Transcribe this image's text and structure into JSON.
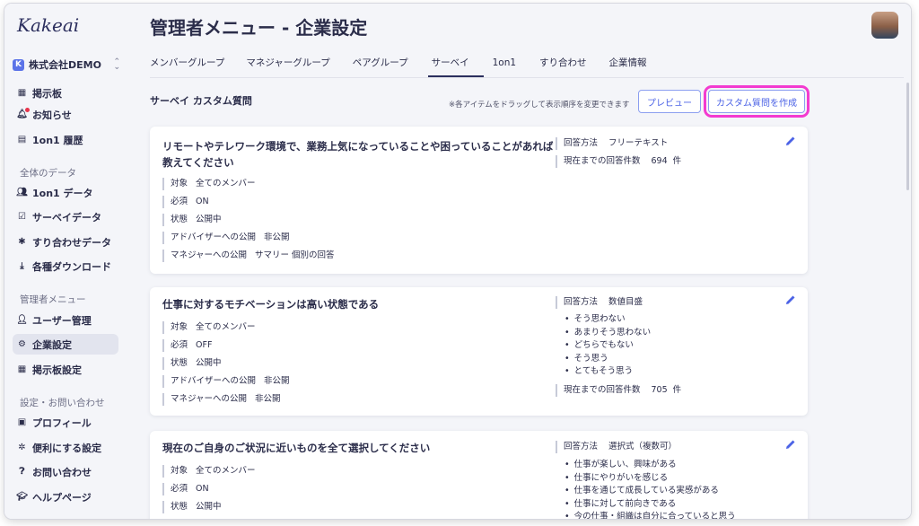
{
  "app": {
    "logo": "Kakeai",
    "company": {
      "badge": "K",
      "name": "株式会社DEMO"
    }
  },
  "sidebar": {
    "items_top": [
      {
        "label": "掲示板",
        "icon": "board-icon"
      },
      {
        "label": "お知らせ",
        "icon": "bell-icon",
        "notification": true
      },
      {
        "label": "1on1 履歴",
        "icon": "history-icon"
      }
    ],
    "section_data": "全体のデータ",
    "items_data": [
      {
        "label": "1on1 データ",
        "icon": "people-icon"
      },
      {
        "label": "サーベイデータ",
        "icon": "survey-icon"
      },
      {
        "label": "すり合わせデータ",
        "icon": "puzzle-icon"
      },
      {
        "label": "各種ダウンロード",
        "icon": "download-icon"
      }
    ],
    "section_admin": "管理者メニュー",
    "items_admin": [
      {
        "label": "ユーザー管理",
        "icon": "user-manage-icon"
      },
      {
        "label": "企業設定",
        "icon": "company-settings-icon",
        "active": true
      },
      {
        "label": "掲示板設定",
        "icon": "board-settings-icon"
      }
    ],
    "section_settings": "設定・お問い合わせ",
    "items_settings": [
      {
        "label": "プロフィール",
        "icon": "profile-icon"
      },
      {
        "label": "便利にする設定",
        "icon": "gear-icon"
      },
      {
        "label": "お問い合わせ",
        "icon": "question-icon"
      },
      {
        "label": "ヘルプページ",
        "icon": "help-cap-icon"
      }
    ]
  },
  "header": {
    "title": "管理者メニュー - 企業設定"
  },
  "tabs": [
    {
      "label": "メンバーグループ"
    },
    {
      "label": "マネジャーグループ"
    },
    {
      "label": "ペアグループ"
    },
    {
      "label": "サーベイ",
      "active": true
    },
    {
      "label": "1on1"
    },
    {
      "label": "すり合わせ"
    },
    {
      "label": "企業情報"
    }
  ],
  "section": {
    "title": "サーベイ カスタム質問",
    "hint": "※各アイテムをドラッグして表示順序を変更できます",
    "preview_label": "プレビュー",
    "create_label": "カスタム質問を作成"
  },
  "questions": [
    {
      "title": "リモートやテレワーク環境で、業務上気になっていることや困っていることがあれば教えてください",
      "attrs": [
        {
          "key": "対象",
          "value": "全てのメンバー"
        },
        {
          "key": "必須",
          "value": "ON"
        },
        {
          "key": "状態",
          "value": "公開中"
        },
        {
          "key": "アドバイザーへの公開",
          "value": "非公開"
        },
        {
          "key": "マネジャーへの公開",
          "value": "サマリー 個別の回答"
        }
      ],
      "method_key": "回答方法",
      "method": "フリーテキスト",
      "options": [],
      "count_key": "現在までの回答件数",
      "count": "694",
      "count_unit": "件"
    },
    {
      "title": "仕事に対するモチベーションは高い状態である",
      "attrs": [
        {
          "key": "対象",
          "value": "全てのメンバー"
        },
        {
          "key": "必須",
          "value": "OFF"
        },
        {
          "key": "状態",
          "value": "公開中"
        },
        {
          "key": "アドバイザーへの公開",
          "value": "非公開"
        },
        {
          "key": "マネジャーへの公開",
          "value": "非公開"
        }
      ],
      "method_key": "回答方法",
      "method": "数値目盛",
      "options": [
        "そう思わない",
        "あまりそう思わない",
        "どちらでもない",
        "そう思う",
        "とてもそう思う"
      ],
      "count_key": "現在までの回答件数",
      "count": "705",
      "count_unit": "件"
    },
    {
      "title": "現在のご自身のご状況に近いものを全て選択してください",
      "attrs": [
        {
          "key": "対象",
          "value": "全てのメンバー"
        },
        {
          "key": "必須",
          "value": "ON"
        },
        {
          "key": "状態",
          "value": "公開中"
        }
      ],
      "method_key": "回答方法",
      "method": "選択式（複数可）",
      "options": [
        "仕事が楽しい、興味がある",
        "仕事にやりがいを感じる",
        "仕事を通じて成長している実感がある",
        "仕事に対して前向きである",
        "今の仕事・組織は自分に合っていると思う"
      ]
    }
  ],
  "colors": {
    "accent": "#4c63e6",
    "highlight": "#f33bd0",
    "navy": "#2c2f5e"
  }
}
